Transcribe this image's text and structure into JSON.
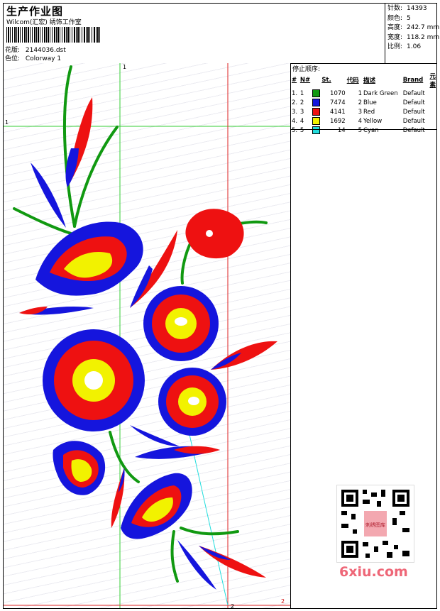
{
  "header": {
    "title": "生产作业图",
    "subtitle": "Wilcom(汇宏) 绣饰工作室",
    "design_label": "花版:",
    "design_value": "2144036.dst",
    "colorway_label": "色位:",
    "colorway_value": "Colorway 1"
  },
  "stats": [
    {
      "label": "针数:",
      "value": "14393"
    },
    {
      "label": "颜色:",
      "value": "5"
    },
    {
      "label": "高度:",
      "value": "242.7 mm"
    },
    {
      "label": "宽度:",
      "value": "118.2 mm"
    },
    {
      "label": "比例:",
      "value": "1.06"
    }
  ],
  "colorlist": {
    "title": "停止顺序:",
    "headers": {
      "num": "#",
      "n": "N#",
      "st": "St.",
      "code": "代码",
      "desc": "描述",
      "brand": "Brand",
      "elem": "元素"
    },
    "rows": [
      {
        "num": "1.",
        "n": "1",
        "color": "#119911",
        "st": "1070",
        "code": "1",
        "desc": "Dark Green",
        "brand": "Default"
      },
      {
        "num": "2.",
        "n": "2",
        "color": "#1515dd",
        "st": "7474",
        "code": "2",
        "desc": "Blue",
        "brand": "Default"
      },
      {
        "num": "3.",
        "n": "3",
        "color": "#ee1111",
        "st": "4141",
        "code": "3",
        "desc": "Red",
        "brand": "Default"
      },
      {
        "num": "4.",
        "n": "4",
        "color": "#f2f200",
        "st": "1692",
        "code": "4",
        "desc": "Yellow",
        "brand": "Default"
      },
      {
        "num": "5.",
        "n": "5",
        "color": "#22dddd",
        "st": "14",
        "code": "5",
        "desc": "Cyan",
        "brand": "Default"
      }
    ]
  },
  "canvas": {
    "guide_label_1a": "1",
    "guide_label_1b": "1",
    "guide_label_2a": "2",
    "guide_label_2b": "2",
    "guide_color_1": "#33cc33",
    "guide_color_2": "#dd2222"
  },
  "watermark": "6xiu.com",
  "watermark_stamp": "刺绣图库",
  "colors": {
    "green": "#119911",
    "blue": "#1515dd",
    "red": "#ee1111",
    "yellow": "#f2f200",
    "cyan": "#22dddd"
  }
}
